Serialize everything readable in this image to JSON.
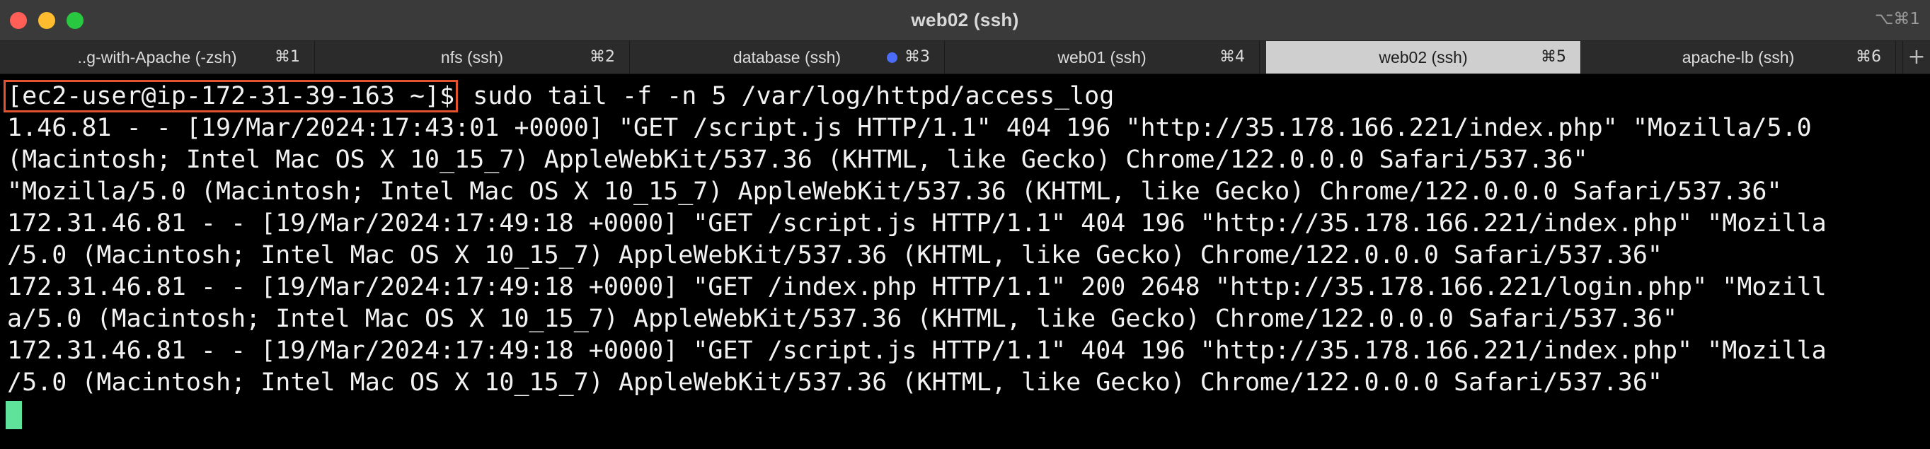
{
  "window": {
    "title": "web02 (ssh)",
    "title_shortcut": "⌥⌘1",
    "traffic_colors": {
      "close": "#ff5f57",
      "minimize": "#febc2e",
      "maximize": "#28c840"
    }
  },
  "tabs": [
    {
      "label": "..g-with-Apache (-zsh)",
      "shortcut": "⌘1",
      "active": false
    },
    {
      "label": "nfs (ssh)",
      "shortcut": "⌘2",
      "active": false
    },
    {
      "label": "database (ssh)",
      "shortcut": "⌘3",
      "active": false,
      "activity_dot_color": "#4a6cf7"
    },
    {
      "label": "web01 (ssh)",
      "shortcut": "⌘4",
      "active": false
    },
    {
      "label": "web02 (ssh)",
      "shortcut": "⌘5",
      "active": true
    },
    {
      "label": "apache-lb (ssh)",
      "shortcut": "⌘6",
      "active": false
    }
  ],
  "new_tab_label": "+",
  "terminal": {
    "prompt": "[ec2-user@ip-172-31-39-163 ~]$",
    "prompt_highlight_color": "#e4532f",
    "command": " sudo tail -f -n 5 /var/log/httpd/access_log",
    "lines": [
      "1.46.81 - - [19/Mar/2024:17:43:01 +0000] \"GET /script.js HTTP/1.1\" 404 196 \"http://35.178.166.221/index.php\" \"Mozilla/5.0",
      "(Macintosh; Intel Mac OS X 10_15_7) AppleWebKit/537.36 (KHTML, like Gecko) Chrome/122.0.0.0 Safari/537.36\"",
      "\"Mozilla/5.0 (Macintosh; Intel Mac OS X 10_15_7) AppleWebKit/537.36 (KHTML, like Gecko) Chrome/122.0.0.0 Safari/537.36\"",
      "172.31.46.81 - - [19/Mar/2024:17:49:18 +0000] \"GET /script.js HTTP/1.1\" 404 196 \"http://35.178.166.221/index.php\" \"Mozilla",
      "/5.0 (Macintosh; Intel Mac OS X 10_15_7) AppleWebKit/537.36 (KHTML, like Gecko) Chrome/122.0.0.0 Safari/537.36\"",
      "172.31.46.81 - - [19/Mar/2024:17:49:18 +0000] \"GET /index.php HTTP/1.1\" 200 2648 \"http://35.178.166.221/login.php\" \"Mozill",
      "a/5.0 (Macintosh; Intel Mac OS X 10_15_7) AppleWebKit/537.36 (KHTML, like Gecko) Chrome/122.0.0.0 Safari/537.36\"",
      "172.31.46.81 - - [19/Mar/2024:17:49:18 +0000] \"GET /script.js HTTP/1.1\" 404 196 \"http://35.178.166.221/index.php\" \"Mozilla",
      "/5.0 (Macintosh; Intel Mac OS X 10_15_7) AppleWebKit/537.36 (KHTML, like Gecko) Chrome/122.0.0.0 Safari/537.36\""
    ],
    "cursor_color": "#5fe39a"
  }
}
